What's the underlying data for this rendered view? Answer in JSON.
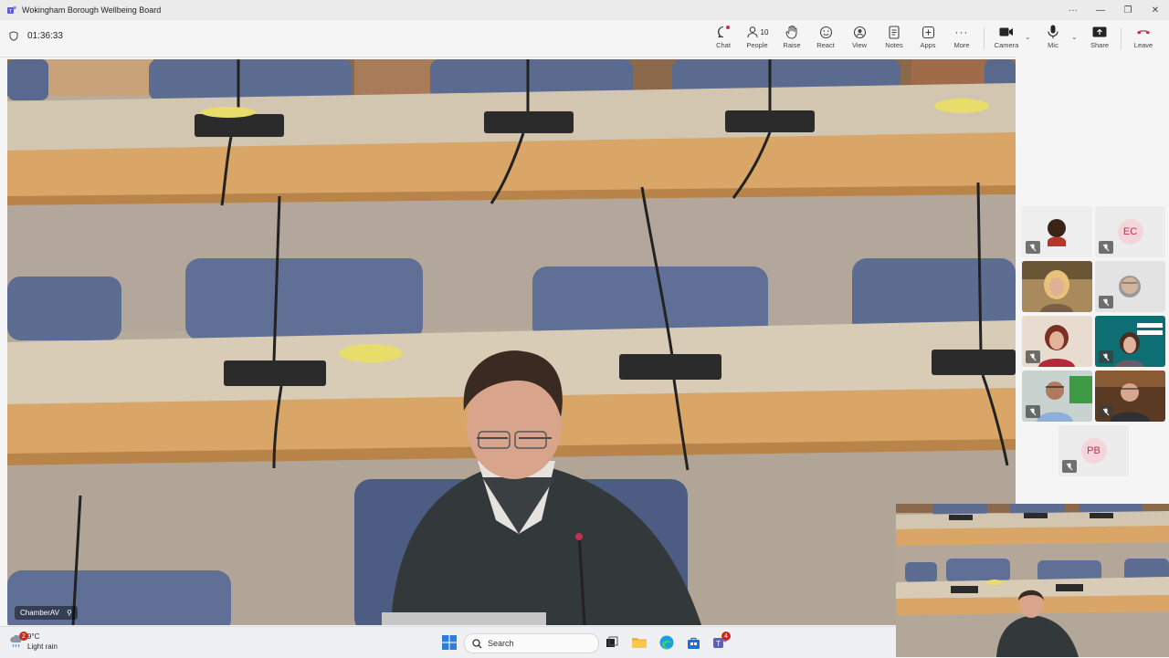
{
  "window": {
    "title": "Wokingham Borough Wellbeing Board",
    "controls": [
      "···",
      "—",
      "❐",
      "✕"
    ]
  },
  "meeting": {
    "elapsed": "01:36:33"
  },
  "toolbar": {
    "chat": "Chat",
    "people": "People",
    "people_count": "10",
    "raise": "Raise",
    "react": "React",
    "view": "View",
    "notes": "Notes",
    "apps": "Apps",
    "more": "More",
    "camera": "Camera",
    "mic": "Mic",
    "share": "Share",
    "leave": "Leave"
  },
  "stage": {
    "speaker_label": "ChamberAV"
  },
  "participants": [
    {
      "initials": "",
      "muted": true,
      "video": true
    },
    {
      "initials": "EC",
      "muted": true,
      "video": false
    },
    {
      "initials": "",
      "muted": false,
      "video": true
    },
    {
      "initials": "",
      "muted": true,
      "video": true
    },
    {
      "initials": "",
      "muted": true,
      "video": true
    },
    {
      "initials": "",
      "muted": true,
      "video": true
    },
    {
      "initials": "",
      "muted": true,
      "video": true
    },
    {
      "initials": "",
      "muted": true,
      "video": true
    },
    {
      "initials": "PB",
      "muted": true,
      "video": false
    }
  ],
  "taskbar": {
    "weather_temp": "9°C",
    "weather_desc": "Light rain",
    "weather_badge": "2",
    "search_placeholder": "Search",
    "teams_badge": "4"
  },
  "colors": {
    "accent": "#5b5fc7",
    "leave": "#c4314b",
    "badge": "#c42b1c"
  }
}
